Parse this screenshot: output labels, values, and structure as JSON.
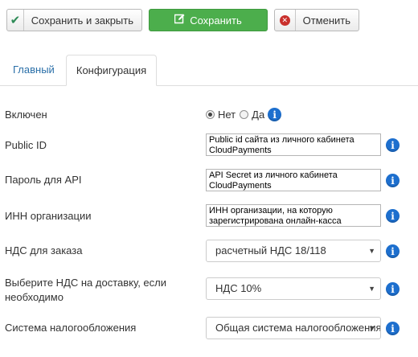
{
  "toolbar": {
    "save_close_label": "Сохранить и закрыть",
    "save_label": "Сохранить",
    "cancel_label": "Отменить",
    "save_color": "#4cae4c"
  },
  "tabs": [
    {
      "label": "Главный",
      "active": false
    },
    {
      "label": "Конфигурация",
      "active": true
    }
  ],
  "form": {
    "enabled": {
      "label": "Включен",
      "options": [
        "Нет",
        "Да"
      ],
      "selected": "Нет"
    },
    "public_id": {
      "label": "Public ID",
      "value": "Public id сайта из личного кабинета CloudPayments"
    },
    "api_password": {
      "label": "Пароль для API",
      "value": "API Secret из личного кабинета CloudPayments"
    },
    "inn": {
      "label": "ИНН организации",
      "value": "ИНН организации, на которую зарегистрирована онлайн-касса"
    },
    "vat_order": {
      "label": "НДС для заказа",
      "value": "расчетный НДС 18/118"
    },
    "vat_delivery": {
      "label": "Выберите НДС на доставку, если необходимо",
      "value": "НДС 10%"
    },
    "tax_system": {
      "label": "Система налогообложения",
      "value": "Общая система налогообложения"
    }
  },
  "icons": {
    "info": "info-icon",
    "check": "check-icon",
    "edit": "edit-icon",
    "cancel": "cancel-icon"
  },
  "colors": {
    "info": "#1d6fce",
    "link": "#2a6fa8",
    "danger": "#c9302c"
  }
}
